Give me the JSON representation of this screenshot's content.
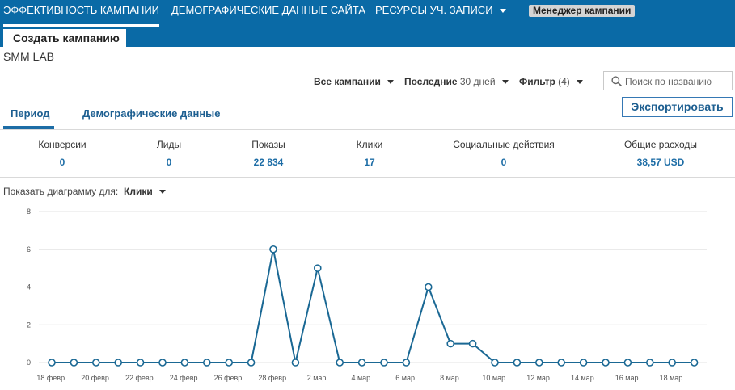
{
  "topnav": {
    "items": [
      {
        "label": "ЭФФЕКТИВНОСТЬ КАМПАНИИ",
        "active": true
      },
      {
        "label": "ДЕМОГРАФИЧЕСКИЕ ДАННЫЕ САЙТА",
        "active": false
      },
      {
        "label": "РЕСУРСЫ УЧ. ЗАПИСИ",
        "active": false
      }
    ],
    "manager_badge": "Менеджер кампании"
  },
  "create_button": "Создать кампанию",
  "account_name": "SMM LAB",
  "filters": {
    "campaigns": "Все кампании",
    "period_prefix": "Последние",
    "period_value": "30 дней",
    "filter_label": "Фильтр",
    "filter_count": "(4)",
    "search_placeholder": "Поиск по названию"
  },
  "tabs": {
    "period": "Период",
    "demographics": "Демографические данные"
  },
  "export_button": "Экспортировать",
  "metrics": [
    {
      "label": "Конверсии",
      "value": "0"
    },
    {
      "label": "Лиды",
      "value": "0"
    },
    {
      "label": "Показы",
      "value": "22 834"
    },
    {
      "label": "Клики",
      "value": "17"
    },
    {
      "label": "Социальные действия",
      "value": "0"
    },
    {
      "label": "Общие расходы",
      "value": "38,57 USD"
    }
  ],
  "chart_controls": {
    "show_for_label": "Показать диаграмму для:",
    "selected_metric": "Клики"
  },
  "colors": {
    "nav_bg": "#0a6aa6",
    "accent": "#1d6da6",
    "line": "#1a6894"
  },
  "chart_data": {
    "type": "line",
    "ylim": [
      0,
      8
    ],
    "yticks": [
      0,
      2,
      4,
      6,
      8
    ],
    "grid": true,
    "x": [
      "18 февр.",
      "19 февр.",
      "20 февр.",
      "21 февр.",
      "22 февр.",
      "23 февр.",
      "24 февр.",
      "25 февр.",
      "26 февр.",
      "27 февр.",
      "28 февр.",
      "1 мар.",
      "2 мар.",
      "3 мар.",
      "4 мар.",
      "5 мар.",
      "6 мар.",
      "7 мар.",
      "8 мар.",
      "9 мар.",
      "10 мар.",
      "11 мар.",
      "12 мар.",
      "13 мар.",
      "14 мар.",
      "15 мар.",
      "16 мар.",
      "17 мар.",
      "18 мар.",
      "19 мар."
    ],
    "xtick_labels": [
      "18 февр.",
      "20 февр.",
      "22 февр.",
      "24 февр.",
      "26 февр.",
      "28 февр.",
      "2 мар.",
      "4 мар.",
      "6 мар.",
      "8 мар.",
      "10 мар.",
      "12 мар.",
      "14 мар.",
      "16 мар.",
      "18 мар."
    ],
    "values": [
      0,
      0,
      0,
      0,
      0,
      0,
      0,
      0,
      0,
      0,
      6,
      0,
      5,
      0,
      0,
      0,
      0,
      4,
      1,
      1,
      0,
      0,
      0,
      0,
      0,
      0,
      0,
      0,
      0,
      0
    ]
  }
}
